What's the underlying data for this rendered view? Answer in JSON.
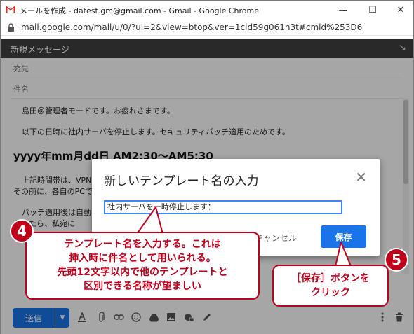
{
  "window": {
    "title": "メールを作成 - datest.gm@gmail.com - Gmail - Google Chrome",
    "minimize": "—",
    "maximize": "☐",
    "close": "✕"
  },
  "address": {
    "url": "mail.google.com/mail/u/0/?ui=2&view=btop&ver=1cid59g061n3t#cmid%253D6"
  },
  "compose": {
    "header_title": "新規メッセージ",
    "expand_icon": "↘",
    "to_label": "宛先",
    "subject_label": "件名",
    "body": {
      "line1": "島田＠管理者モードです。お疲れさまです。",
      "line2": "以下の日時に社内サーバを停止します。セキュリティパッチ適用のためです。",
      "heading": "yyyy年mm月dd日 AM2:30～AM5:30",
      "line3": "上記時間帯は、VPN",
      "line4": "その前に、各自のPCで",
      "line5": "パッチ適用後は自動",
      "line6": "かったら、私宛に"
    }
  },
  "toolbar": {
    "send_label": "送信",
    "send_dropdown": "▼"
  },
  "dialog": {
    "title": "新しいテンプレート名の入力",
    "close_icon": "✕",
    "input_value": "社内サーバを一時停止します：",
    "cancel_label": "キャンセル",
    "save_label": "保存"
  },
  "callouts": {
    "c4": {
      "number": "4",
      "line1": "テンプレート名を入力する。これは",
      "line2": "挿入時に件名として用いられる。",
      "line3": "先頭12文字以内で他のテンプレートと",
      "line4": "区別できる名称が望ましい"
    },
    "c5": {
      "number": "5",
      "line1": "［保存］ボタンを",
      "line2": "クリック"
    }
  },
  "colors": {
    "accent": "#1a73e8",
    "callout": "#c0001b",
    "header": "#404040"
  }
}
